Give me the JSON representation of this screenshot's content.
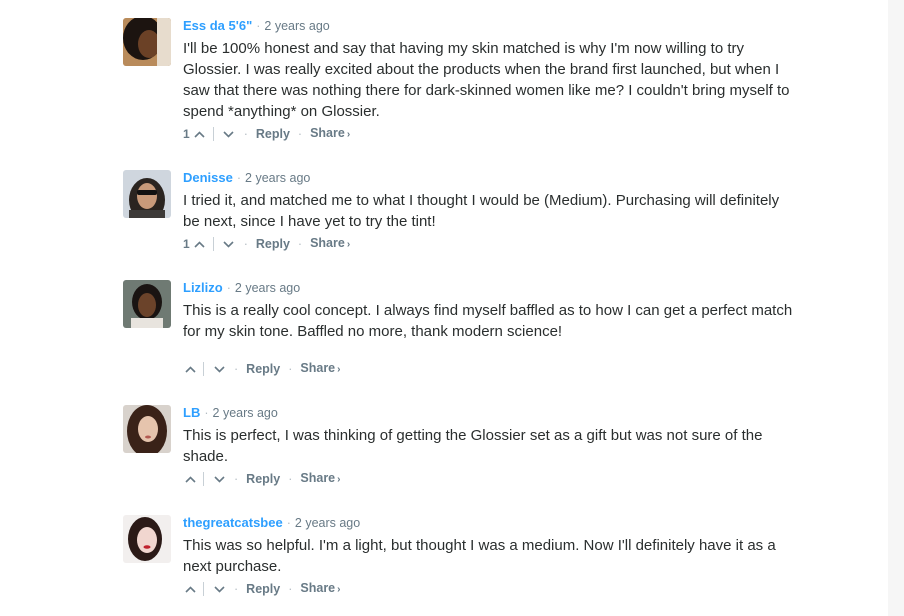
{
  "labels": {
    "reply": "Reply",
    "share": "Share",
    "separator": "·",
    "share_arrow": "›"
  },
  "colors": {
    "author": "#2e9fff",
    "meta": "#687a86",
    "text": "#2a2e2e"
  },
  "icons": {
    "upvote": "chevron-up-icon",
    "downvote": "chevron-down-icon"
  },
  "comments": [
    {
      "author": "Ess da 5'6\"",
      "time": "2 years ago",
      "paragraphs": [
        "I'll be 100% honest and say that having my skin matched is why I'm now willing to try Glossier. I was really excited about the products when the brand first launched, but when I saw that there was nothing there for dark-skinned women like me? I couldn't bring myself to spend *anything* on Glossier."
      ],
      "votes": "1"
    },
    {
      "author": "Denisse",
      "time": "2 years ago",
      "paragraphs": [
        "I tried it, and matched me to what I thought I would be (Medium). Purchasing will definitely be next, since I have yet to try the tint!"
      ],
      "votes": "1"
    },
    {
      "author": "Lizlizo",
      "time": "2 years ago",
      "paragraphs": [
        "This is a really cool concept. I always find myself baffled as to how I can get a perfect match for my skin tone. Baffled no more, thank modern science!"
      ],
      "votes": ""
    },
    {
      "author": "LB",
      "time": "2 years ago",
      "paragraphs": [
        "This is perfect, I was thinking of getting the Glossier set as a gift but was not sure of the shade."
      ],
      "votes": ""
    },
    {
      "author": "thegreatcatsbee",
      "time": "2 years ago",
      "paragraphs": [
        "This was so helpful. I'm a light, but thought I was a medium. Now I'll definitely have it as a next purchase."
      ],
      "votes": ""
    }
  ]
}
